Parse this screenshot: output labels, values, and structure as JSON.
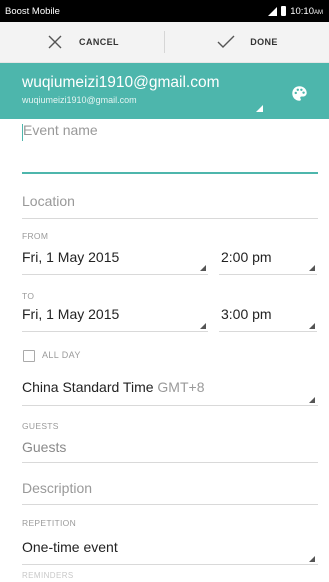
{
  "status_bar": {
    "carrier": "Boost Mobile",
    "time": "10:10",
    "ampm": "AM"
  },
  "action_bar": {
    "cancel_label": "CANCEL",
    "done_label": "DONE"
  },
  "account": {
    "name": "wuqiumeizi1910@gmail.com",
    "email": "wuqiumeizi1910@gmail.com",
    "accent_color": "#4db6ac"
  },
  "form": {
    "event_name_placeholder": "Event name",
    "location_placeholder": "Location",
    "from_label": "FROM",
    "from_date": "Fri, 1 May 2015",
    "from_time": "2:00 pm",
    "to_label": "TO",
    "to_date": "Fri, 1 May 2015",
    "to_time": "3:00 pm",
    "all_day_label": "ALL DAY",
    "all_day_checked": false,
    "timezone_name": "China Standard Time",
    "timezone_offset": "GMT+8",
    "guests_label": "GUESTS",
    "guests_placeholder": "Guests",
    "description_placeholder": "Description",
    "repetition_label": "REPETITION",
    "repetition_value": "One-time event",
    "reminders_label": "REMINDERS"
  }
}
